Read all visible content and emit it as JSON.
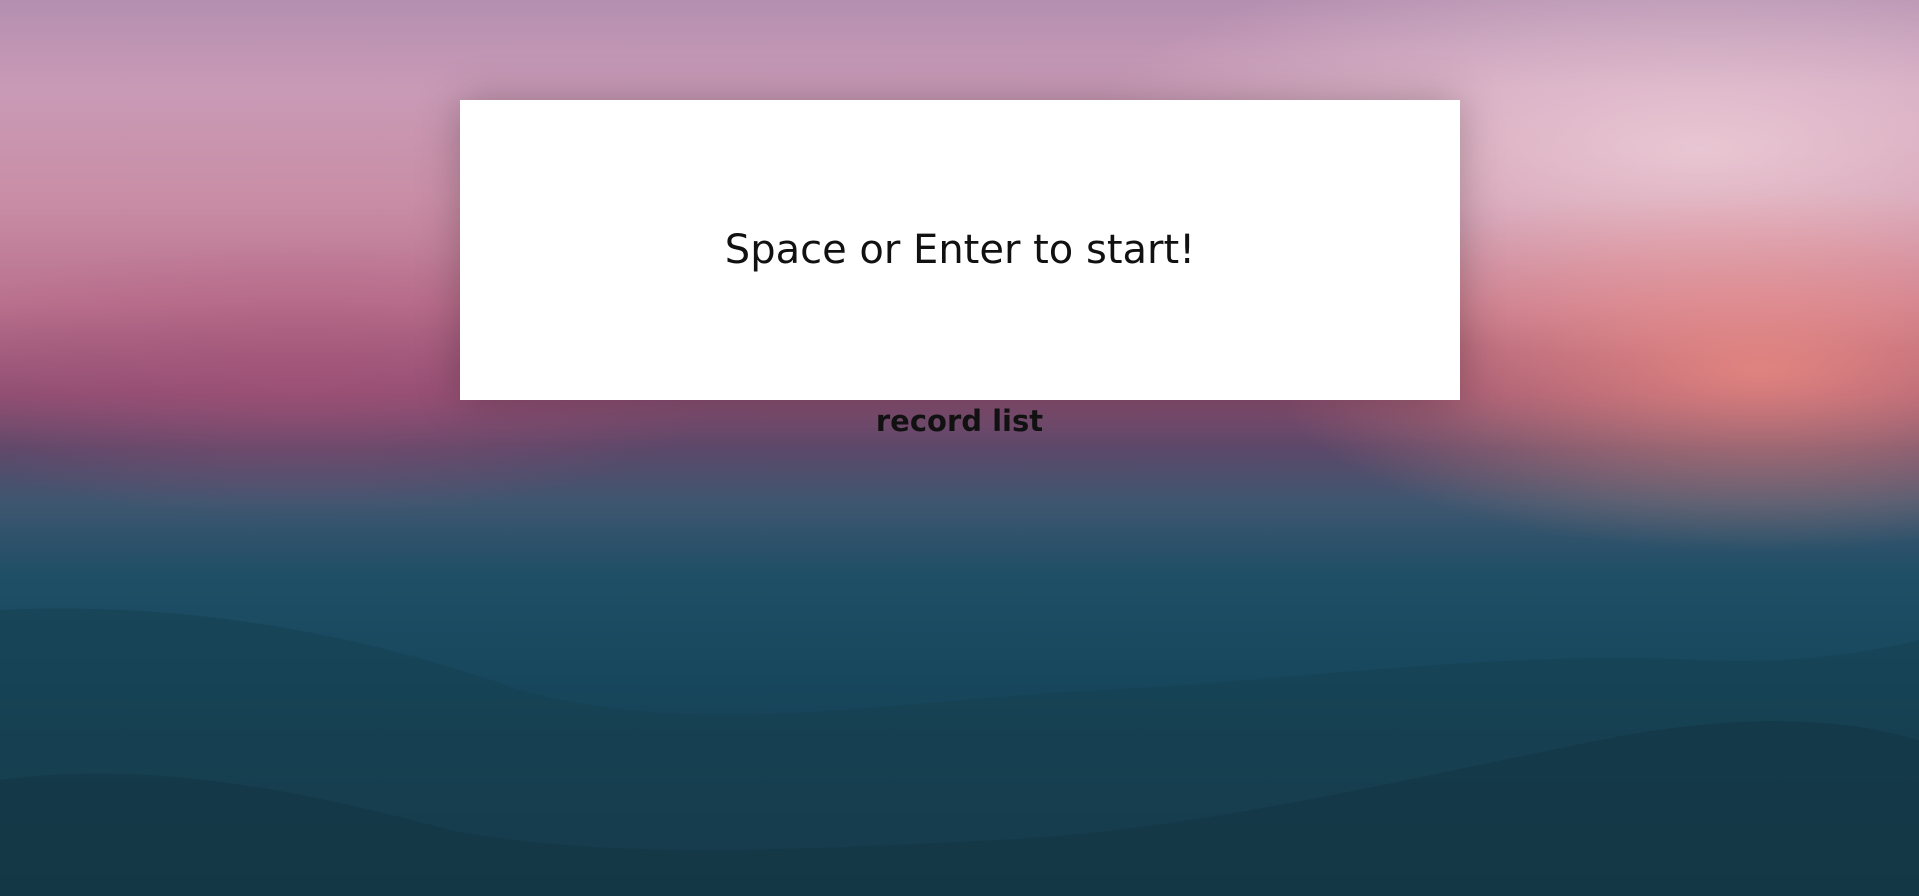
{
  "game": {
    "start_prompt": "Space or Enter to start!",
    "record_link_label": "record list"
  },
  "background": {
    "description_colors": {
      "sky_top": "#b48fb0",
      "sunset_glow": "#ff9682",
      "horizon": "#8e4f72",
      "sea": "#1f4f66",
      "ground": "#163645"
    }
  }
}
